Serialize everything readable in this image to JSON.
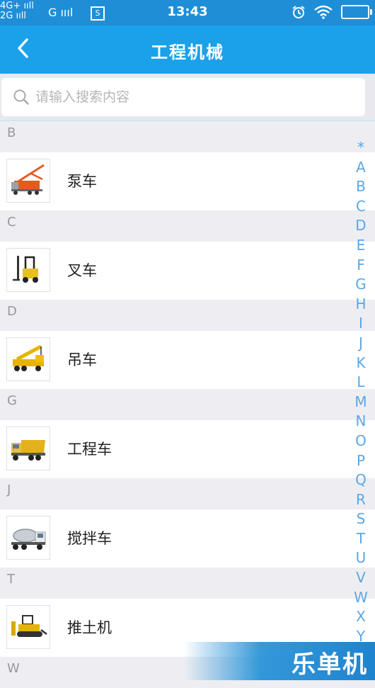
{
  "status": {
    "net1": "4G+ ııll",
    "net2": "2G ııll",
    "net3": "G ıııl",
    "s_badge": "S",
    "time": "13:43"
  },
  "nav": {
    "title": "工程机械"
  },
  "search": {
    "placeholder": "请输入搜索内容"
  },
  "sections": [
    {
      "letter": "B",
      "items": [
        {
          "label": "泵车",
          "icon": "pump-truck-icon"
        }
      ]
    },
    {
      "letter": "C",
      "items": [
        {
          "label": "叉车",
          "icon": "forklift-icon"
        }
      ]
    },
    {
      "letter": "D",
      "items": [
        {
          "label": "吊车",
          "icon": "crane-truck-icon"
        }
      ]
    },
    {
      "letter": "G",
      "items": [
        {
          "label": "工程车",
          "icon": "dump-truck-icon"
        }
      ]
    },
    {
      "letter": "J",
      "items": [
        {
          "label": "搅拌车",
          "icon": "mixer-truck-icon"
        }
      ]
    },
    {
      "letter": "T",
      "items": [
        {
          "label": "推土机",
          "icon": "bulldozer-icon"
        }
      ]
    },
    {
      "letter": "W",
      "items": []
    }
  ],
  "index_letters": [
    "*",
    "A",
    "B",
    "C",
    "D",
    "E",
    "F",
    "G",
    "H",
    "I",
    "J",
    "K",
    "L",
    "M",
    "N",
    "O",
    "P",
    "Q",
    "R",
    "S",
    "T",
    "U",
    "V",
    "W",
    "X",
    "Y"
  ],
  "watermark": {
    "text": "乐单机"
  },
  "colors": {
    "status_bar": "#1f8ed6",
    "nav_bar": "#1ba1ea",
    "index_letters": "#5aa8e6"
  }
}
